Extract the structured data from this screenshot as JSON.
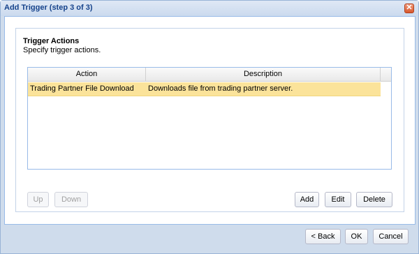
{
  "window": {
    "title": "Add Trigger (step 3 of 3)",
    "close_glyph": "✕"
  },
  "section": {
    "title": "Trigger Actions",
    "subtitle": "Specify trigger actions."
  },
  "grid": {
    "columns": [
      "Action",
      "Description"
    ],
    "rows": [
      {
        "action": "Trading Partner File Download",
        "description": "Downloads file from trading partner server."
      }
    ]
  },
  "buttons": {
    "up": "Up",
    "down": "Down",
    "add": "Add",
    "edit": "Edit",
    "delete": "Delete",
    "back": "< Back",
    "ok": "OK",
    "cancel": "Cancel"
  },
  "colors": {
    "title_text": "#15428b",
    "selected_row": "#fbe39a",
    "close_button": "#d8572c"
  },
  "icons": {
    "close": "close-icon"
  }
}
